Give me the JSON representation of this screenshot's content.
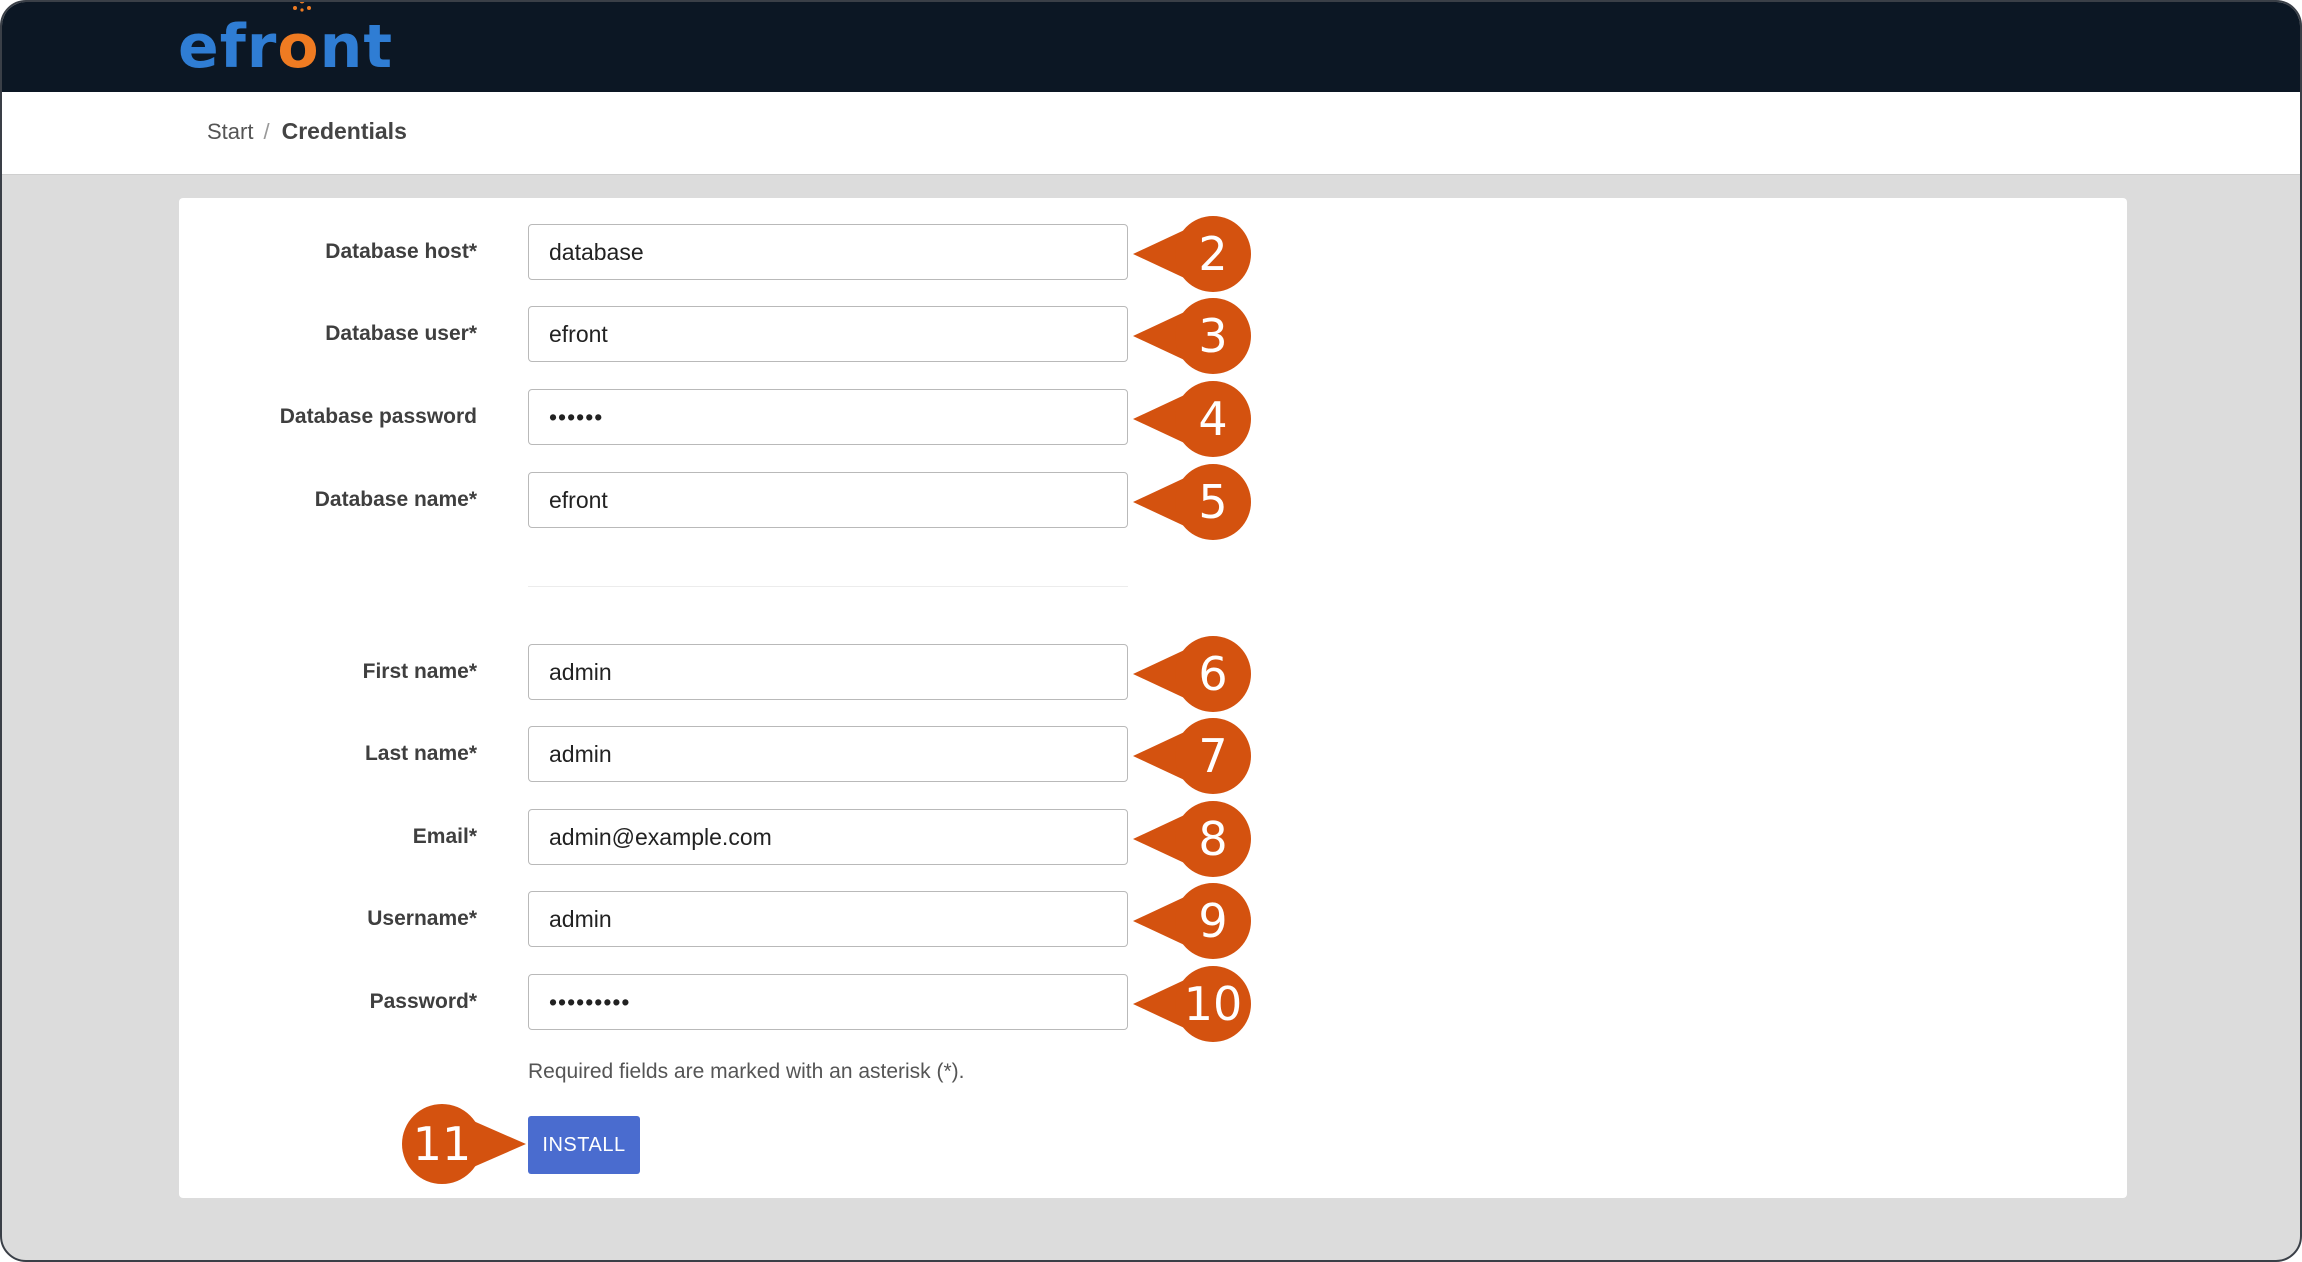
{
  "app": {
    "logo_prefix": "efr",
    "logo_o": "o",
    "logo_suffix": "nt"
  },
  "breadcrumb": {
    "items": [
      "Start",
      "Credentials"
    ],
    "separator": "/"
  },
  "form": {
    "database_fields": [
      {
        "label": "Database host*",
        "value": "database",
        "callout": "2"
      },
      {
        "label": "Database user*",
        "value": "efront",
        "callout": "3"
      },
      {
        "label": "Database password",
        "value": "••••••",
        "callout": "4"
      },
      {
        "label": "Database name*",
        "value": "efront",
        "callout": "5"
      }
    ],
    "admin_fields": [
      {
        "label": "First name*",
        "value": "admin",
        "callout": "6"
      },
      {
        "label": "Last name*",
        "value": "admin",
        "callout": "7"
      },
      {
        "label": "Email*",
        "value": "admin@example.com",
        "callout": "8"
      },
      {
        "label": "Username*",
        "value": "admin",
        "callout": "9"
      },
      {
        "label": "Password*",
        "value": "•••••••••",
        "callout": "10"
      }
    ],
    "required_note": "Required fields are marked with an asterisk (*).",
    "install_label": "INSTALL",
    "install_callout": "11"
  },
  "colors": {
    "topbar": "#0c1724",
    "logo_blue": "#2f7dd4",
    "logo_orange": "#ef7b22",
    "callout": "#d4520f",
    "button": "#4a6ccf",
    "page_bg": "#dcdcdc"
  }
}
